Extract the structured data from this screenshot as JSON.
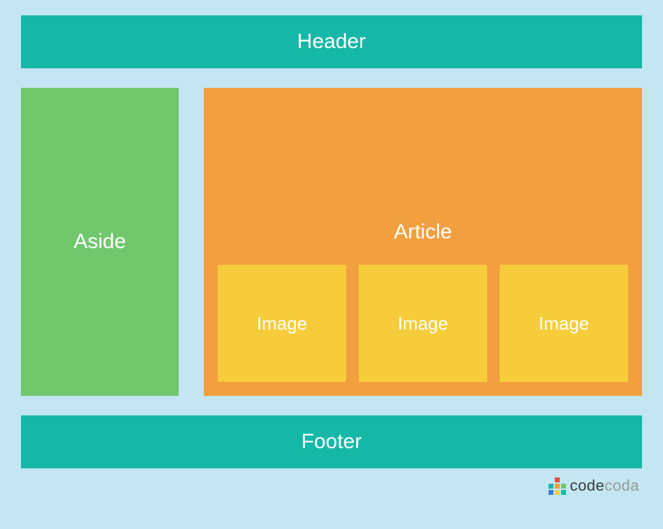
{
  "layout": {
    "header": "Header",
    "aside": "Aside",
    "article": "Article",
    "images": [
      "Image",
      "Image",
      "Image"
    ],
    "footer": "Footer"
  },
  "branding": {
    "text_dark": "code",
    "text_light": "coda"
  },
  "colors": {
    "background": "#c3e6f2",
    "header_footer": "#15b8a6",
    "aside": "#70c76c",
    "article": "#f2a03f",
    "image": "#f7cc3b"
  }
}
